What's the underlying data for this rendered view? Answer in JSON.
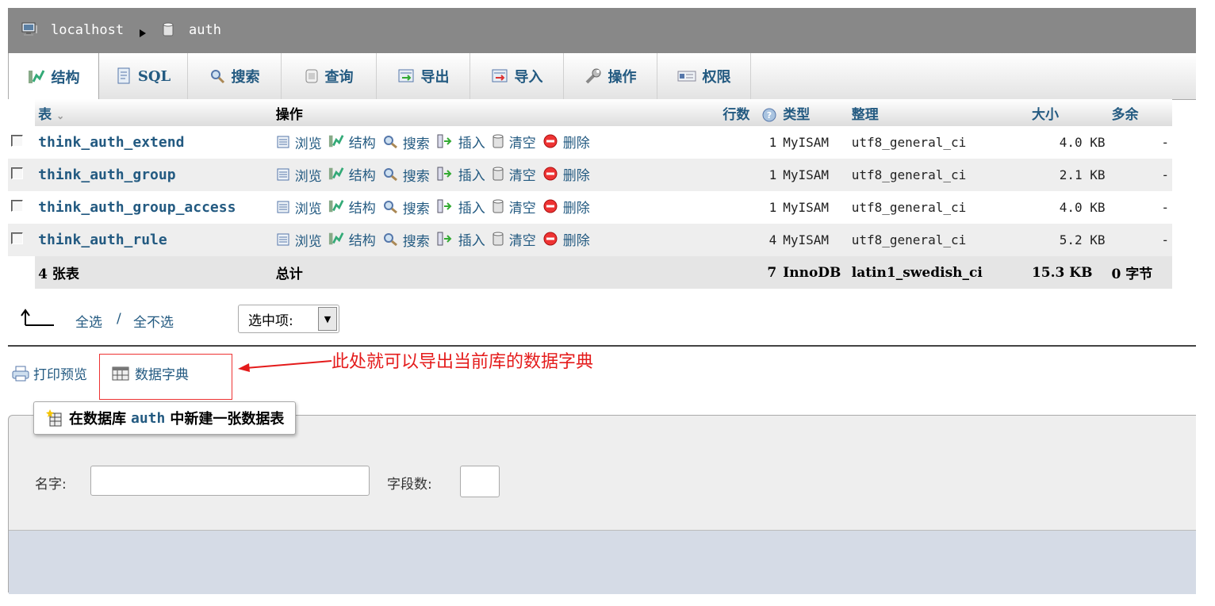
{
  "breadcrumb": {
    "server": "localhost",
    "database": "auth"
  },
  "tabs": [
    {
      "label": "结构",
      "icon": "structure-icon"
    },
    {
      "label": "SQL",
      "icon": "sql-icon"
    },
    {
      "label": "搜索",
      "icon": "search-icon"
    },
    {
      "label": "查询",
      "icon": "query-icon"
    },
    {
      "label": "导出",
      "icon": "export-icon"
    },
    {
      "label": "导入",
      "icon": "import-icon"
    },
    {
      "label": "操作",
      "icon": "wrench-icon"
    },
    {
      "label": "权限",
      "icon": "privileges-icon"
    }
  ],
  "table": {
    "headers": {
      "table": "表",
      "sort": "⌄",
      "actions": "操作",
      "rows": "行数",
      "type": "类型",
      "collation": "整理",
      "size": "大小",
      "overhead": "多余"
    },
    "actions": {
      "browse": "浏览",
      "structure": "结构",
      "search": "搜索",
      "insert": "插入",
      "empty": "清空",
      "drop": "删除"
    },
    "rows": [
      {
        "name": "think_auth_extend",
        "rows": "1",
        "type": "MyISAM",
        "collation": "utf8_general_ci",
        "size": "4.0 KB",
        "overhead": "-"
      },
      {
        "name": "think_auth_group",
        "rows": "1",
        "type": "MyISAM",
        "collation": "utf8_general_ci",
        "size": "2.1 KB",
        "overhead": "-"
      },
      {
        "name": "think_auth_group_access",
        "rows": "1",
        "type": "MyISAM",
        "collation": "utf8_general_ci",
        "size": "4.0 KB",
        "overhead": "-"
      },
      {
        "name": "think_auth_rule",
        "rows": "4",
        "type": "MyISAM",
        "collation": "utf8_general_ci",
        "size": "5.2 KB",
        "overhead": "-"
      }
    ],
    "footer": {
      "count": "4 张表",
      "total": "总计",
      "rows": "7",
      "type": "InnoDB",
      "collation": "latin1_swedish_ci",
      "size": "15.3 KB",
      "overhead": "0 字节"
    }
  },
  "selection": {
    "select_all": "全选",
    "divider": "/",
    "select_none": "全不选",
    "with_selected": "选中项:"
  },
  "links": {
    "print": "打印预览",
    "dictionary": "数据字典"
  },
  "annotation": "此处就可以导出当前库的数据字典",
  "create_table": {
    "prefix": "在数据库",
    "database": "auth",
    "suffix": "中新建一张数据表",
    "name_label": "名字:",
    "name_value": "",
    "fields_label": "字段数:",
    "fields_value": ""
  },
  "colors": {
    "link": "#235a81",
    "annotation": "#e41b1b",
    "header_bar": "#888888"
  }
}
